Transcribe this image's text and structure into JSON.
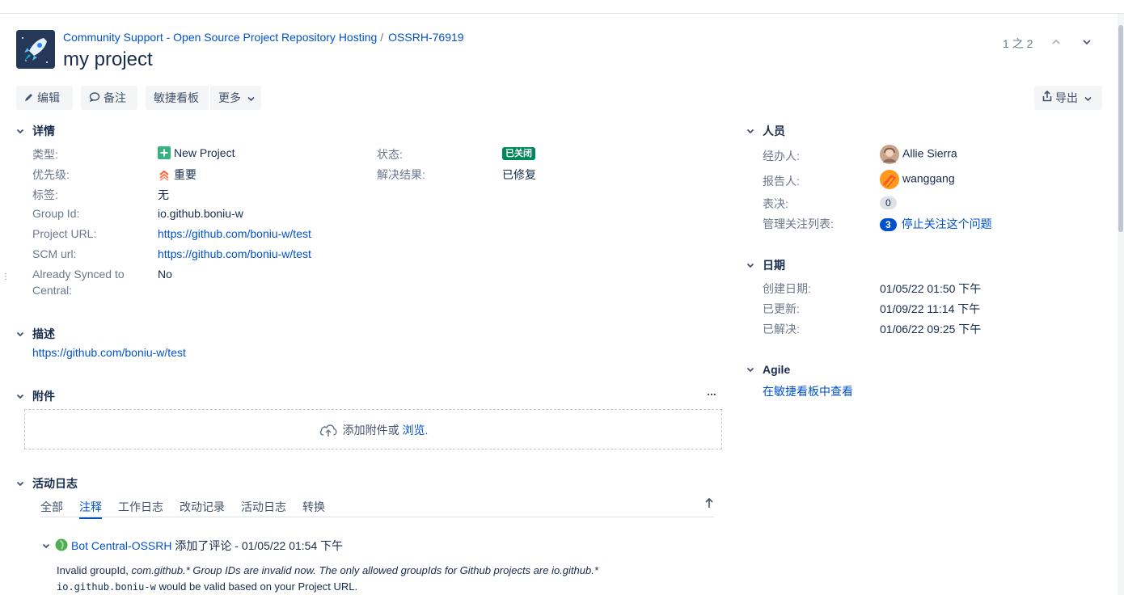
{
  "breadcrumb": {
    "project": "Community Support - Open Source Project Repository Hosting",
    "issue_key": "OSSRH-76919"
  },
  "issue_title": "my project",
  "pager": {
    "text": "1 之 2"
  },
  "toolbar": {
    "edit": "编辑",
    "comment": "备注",
    "agile_board": "敏捷看板",
    "more": "更多",
    "export": "导出"
  },
  "details": {
    "heading": "详情",
    "type_label": "类型:",
    "type_value": "New Project",
    "priority_label": "优先级:",
    "priority_value": "重要",
    "labels_label": "标签:",
    "labels_value": "无",
    "group_id_label": "Group Id:",
    "group_id_value": "io.github.boniu-w",
    "project_url_label": "Project URL:",
    "project_url_value": "https://github.com/boniu-w/test",
    "scm_url_label": "SCM url:",
    "scm_url_value": "https://github.com/boniu-w/test",
    "synced_label_1": "Already Synced to",
    "synced_label_2": "Central:",
    "synced_value": "No",
    "status_label": "状态:",
    "status_value": "已关闭",
    "resolution_label": "解决结果:",
    "resolution_value": "已修复"
  },
  "description": {
    "heading": "描述",
    "text": "https://github.com/boniu-w/test"
  },
  "attachments": {
    "heading": "附件",
    "more_icon": "...",
    "drop_text": "添加附件或",
    "browse": "浏览."
  },
  "activity": {
    "heading": "活动日志",
    "tabs": [
      "全部",
      "注释",
      "工作日志",
      "改动记录",
      "活动日志",
      "转换"
    ],
    "active_tab": "注释",
    "comment": {
      "author": "Bot Central-OSSRH",
      "action": "添加了评论 - 01/05/22 01:54 下午",
      "line1_a": "Invalid groupId, ",
      "line1_b": "com.github.* Group IDs are invalid now. The only allowed groupIds for Github projects are io.github.*",
      "line2_code": "io.github.boniu-w",
      "line2_rest": " would be valid based on your Project URL."
    }
  },
  "people": {
    "heading": "人员",
    "assignee_label": "经办人:",
    "assignee_value": "Allie Sierra",
    "reporter_label": "报告人:",
    "reporter_value": "wanggang",
    "votes_label": "表决:",
    "votes_value": "0",
    "watchers_label": "管理关注列表:",
    "watchers_count": "3",
    "watchers_action": "停止关注这个问题"
  },
  "dates": {
    "heading": "日期",
    "created_label": "创建日期:",
    "created_value": "01/05/22 01:50 下午",
    "updated_label": "已更新:",
    "updated_value": "01/09/22 11:14 下午",
    "resolved_label": "已解决:",
    "resolved_value": "01/06/22 09:25 下午"
  },
  "agile": {
    "heading": "Agile",
    "link": "在敏捷看板中查看"
  },
  "colors": {
    "link": "#0052cc",
    "status_closed": "#00875a",
    "new_project_icon": "#36b37e",
    "priority_icon": "#ff5630"
  }
}
